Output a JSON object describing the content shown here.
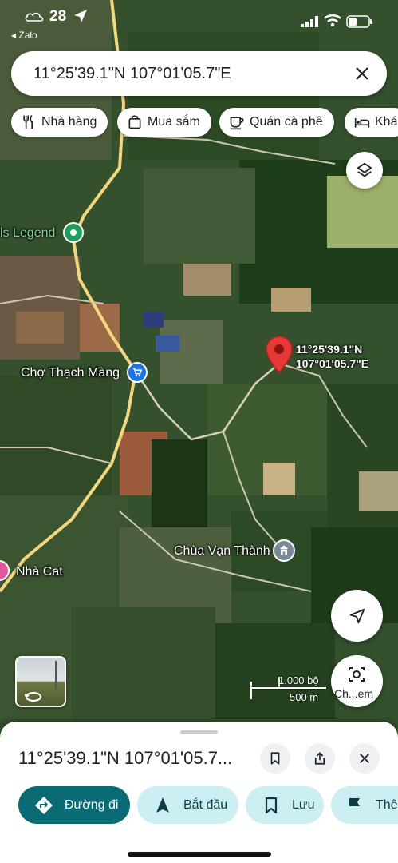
{
  "status_bar": {
    "time": "28",
    "back_app": "◂ Zalo"
  },
  "search": {
    "query": "11°25'39.1\"N 107°01'05.7\"E"
  },
  "chips": [
    {
      "label": "Nhà hàng",
      "icon": "fork-knife-icon"
    },
    {
      "label": "Mua sắm",
      "icon": "shopping-bag-icon"
    },
    {
      "label": "Quán cà phê",
      "icon": "coffee-cup-icon"
    },
    {
      "label": "Khá",
      "icon": "bed-icon"
    }
  ],
  "map": {
    "labels": {
      "legend": "ls Legend",
      "market": "Chợ Thạch Màng",
      "pagoda": "Chùa Vạn Thành",
      "nha_cat": "Nhà Cat"
    },
    "pin_label_line1": "11°25'39.1\"N",
    "pin_label_line2": "107°01'05.7\"E",
    "scale_top": "1.000 bộ",
    "scale_bottom": "500 m",
    "streetview_label": "Ch...em"
  },
  "sheet": {
    "title": "11°25'39.1\"N 107°01'05.7...",
    "actions": [
      {
        "label": "Đường đi",
        "style": "primary",
        "icon": "directions-icon"
      },
      {
        "label": "Bắt đầu",
        "style": "secondary",
        "icon": "navigation-arrow-icon"
      },
      {
        "label": "Lưu",
        "style": "secondary",
        "icon": "bookmark-icon"
      },
      {
        "label": "Thên",
        "style": "secondary",
        "icon": "flag-icon"
      }
    ]
  },
  "colors": {
    "pin": "#e53935",
    "primary_action": "#0b6b75",
    "secondary_action": "#cdeef3",
    "road": "#f2d680"
  }
}
